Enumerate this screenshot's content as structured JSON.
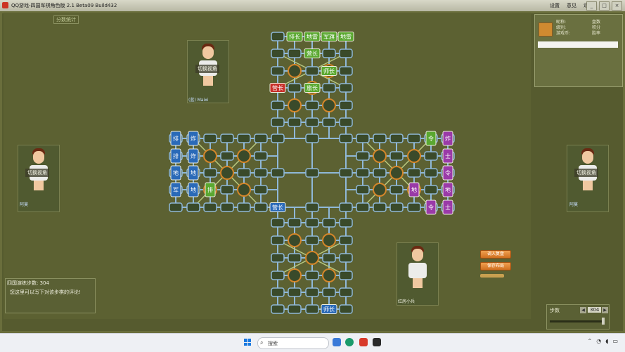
{
  "window": {
    "title": "QQ游戏-四国军棋角色版 2.1 Beta09 Build432",
    "menu": [
      "设置",
      "意见",
      "退出"
    ],
    "controls": [
      "minimize",
      "maximize",
      "close"
    ]
  },
  "score_tab": "分数统计",
  "players": {
    "top": {
      "view_button": "切换视角",
      "name": "(蓝) Maixi"
    },
    "left": {
      "view_button": "切换视角",
      "name": "阿莫"
    },
    "right": {
      "view_button": "切换视角",
      "name": "阿莫"
    },
    "bottom": {
      "name": "红房小兵"
    }
  },
  "info_panel": {
    "rows": [
      {
        "label": "昵称:",
        "value": "盘数"
      },
      {
        "label": "级别:",
        "value": "积分"
      },
      {
        "label": "游戏币:",
        "value": "胜率"
      }
    ]
  },
  "chat": {
    "title": "四国演练步数: 304",
    "hint": "您这里可以写下对该步棋的评论!"
  },
  "buttons": {
    "load_replay": "调入复盘",
    "save_layout": "保存布局"
  },
  "steps": {
    "label": "步数",
    "value": "304"
  },
  "taskbar": {
    "search_placeholder": "搜索"
  },
  "pieces": [
    {
      "label": "排长",
      "color": "#5aa830"
    },
    {
      "label": "地雷",
      "color": "#5aa830"
    },
    {
      "label": "军旗",
      "color": "#5aa830"
    },
    {
      "label": "地雷",
      "color": "#5aa830"
    },
    {
      "label": "营长",
      "color": "#5aa830"
    },
    {
      "label": "师长",
      "color": "#5aa830"
    },
    {
      "label": "营长",
      "color": "#c8302a"
    },
    {
      "label": "旅长",
      "color": "#5aa830"
    },
    {
      "label": "排长",
      "color": "#2a6ab8"
    },
    {
      "label": "炸弹",
      "color": "#2a6ab8"
    },
    {
      "label": "排长",
      "color": "#2a6ab8"
    },
    {
      "label": "炸弹",
      "color": "#2a6ab8"
    },
    {
      "label": "地雷",
      "color": "#2a6ab8"
    },
    {
      "label": "地雷",
      "color": "#2a6ab8"
    },
    {
      "label": "军旗",
      "color": "#2a6ab8"
    },
    {
      "label": "地雷",
      "color": "#2a6ab8"
    },
    {
      "label": "排长",
      "color": "#5aa830"
    },
    {
      "label": "营长",
      "color": "#2a6ab8"
    },
    {
      "label": "令司",
      "color": "#5aa830"
    },
    {
      "label": "士卒",
      "color": "#9a3aa8"
    },
    {
      "label": "令排",
      "color": "#9a3aa8"
    },
    {
      "label": "地雷",
      "color": "#9a3aa8"
    },
    {
      "label": "地雷",
      "color": "#9a3aa8"
    },
    {
      "label": "士卒",
      "color": "#9a3aa8"
    },
    {
      "label": "令司",
      "color": "#9a3aa8"
    },
    {
      "label": "炸弹",
      "color": "#9a3aa8"
    },
    {
      "label": "师长",
      "color": "#2a6ab8"
    }
  ],
  "colors": {
    "board_line": "#8fb8d8",
    "station_fill": "#3a4a2a",
    "camp": "#d4862a",
    "accent_orange": "#e88a30"
  }
}
